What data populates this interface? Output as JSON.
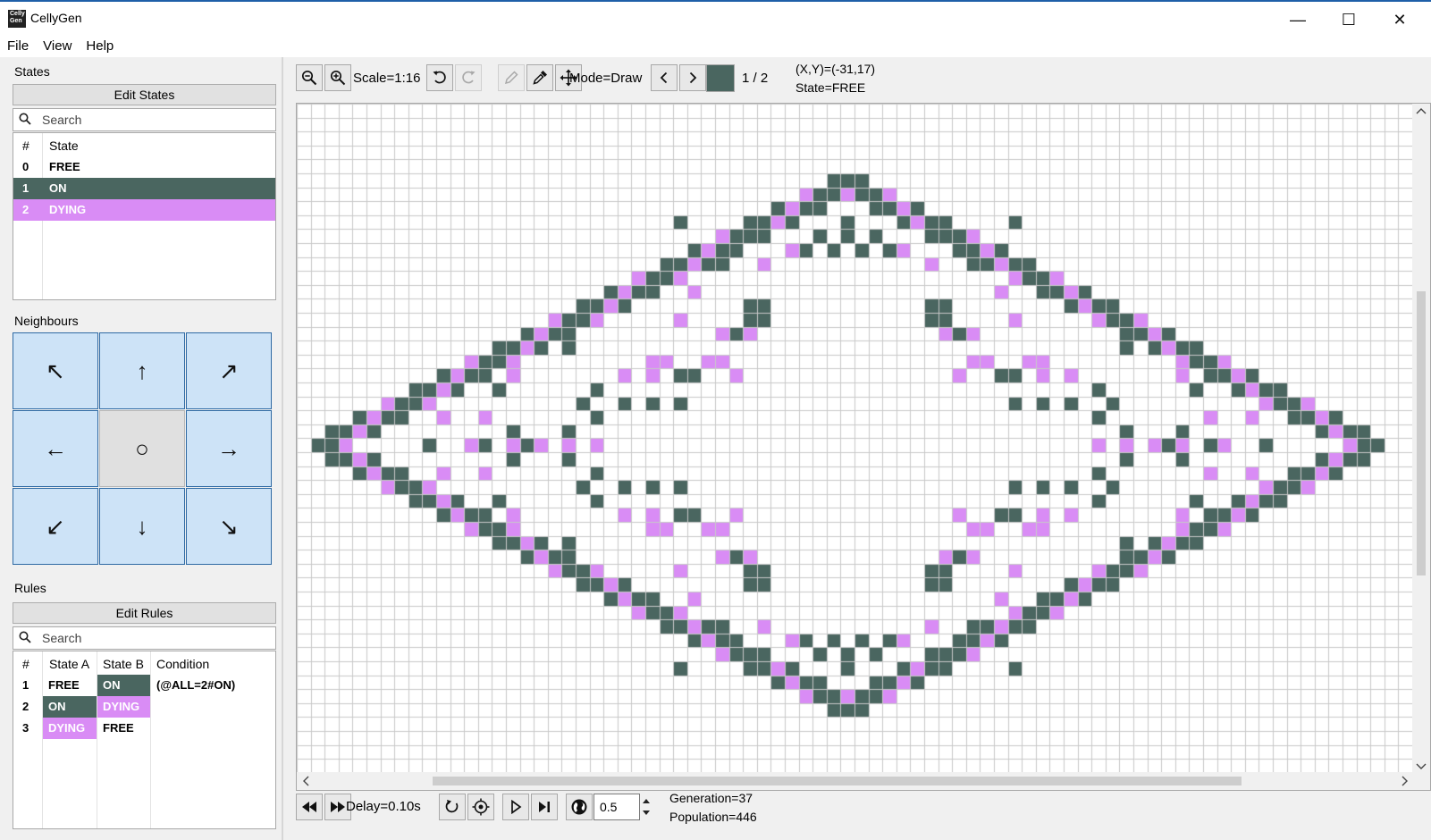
{
  "window": {
    "title": "CellyGen",
    "minimize_glyph": "—",
    "maximize_glyph": "☐",
    "close_glyph": "✕",
    "icon_text": "Celly Gen"
  },
  "menu": [
    "File",
    "View",
    "Help"
  ],
  "states": {
    "heading": "States",
    "edit_label": "Edit States",
    "search_placeholder": "Search",
    "columns": [
      "#",
      "State"
    ],
    "rows": [
      {
        "num": "0",
        "name": "FREE",
        "bg": "#ffffff",
        "fg": "#000000"
      },
      {
        "num": "1",
        "name": "ON",
        "bg": "#4a6660",
        "fg": "#ffffff"
      },
      {
        "num": "2",
        "name": "DYING",
        "bg": "#d98cf5",
        "fg": "#ffffff"
      }
    ]
  },
  "neighbours": {
    "heading": "Neighbours",
    "arrows": [
      "↖",
      "↑",
      "↗",
      "←",
      "○",
      "→",
      "↙",
      "↓",
      "↘"
    ]
  },
  "rules": {
    "heading": "Rules",
    "edit_label": "Edit Rules",
    "search_placeholder": "Search",
    "columns": [
      "#",
      "State A",
      "State B",
      "Condition"
    ],
    "rows": [
      {
        "num": "1",
        "a": "FREE",
        "b": "ON",
        "cond": "(@ALL=2#ON)"
      },
      {
        "num": "2",
        "a": "ON",
        "b": "DYING",
        "cond": ""
      },
      {
        "num": "3",
        "a": "DYING",
        "b": "FREE",
        "cond": ""
      }
    ]
  },
  "toolbar": {
    "scale": "Scale=1:16",
    "mode": "Mode=Draw",
    "page": "1 / 2",
    "coords": "(X,Y)=(-31,17)",
    "state": "State=FREE",
    "current_color": "#4a6660"
  },
  "bottom": {
    "delay": "Delay=0.10s",
    "speed": "0.5",
    "generation": "Generation=37",
    "population": "Population=446"
  },
  "colors": {
    "on": "#4a6660",
    "dying": "#d98cf5",
    "grid": "#c8c8c8",
    "selection": "#4a6660"
  }
}
